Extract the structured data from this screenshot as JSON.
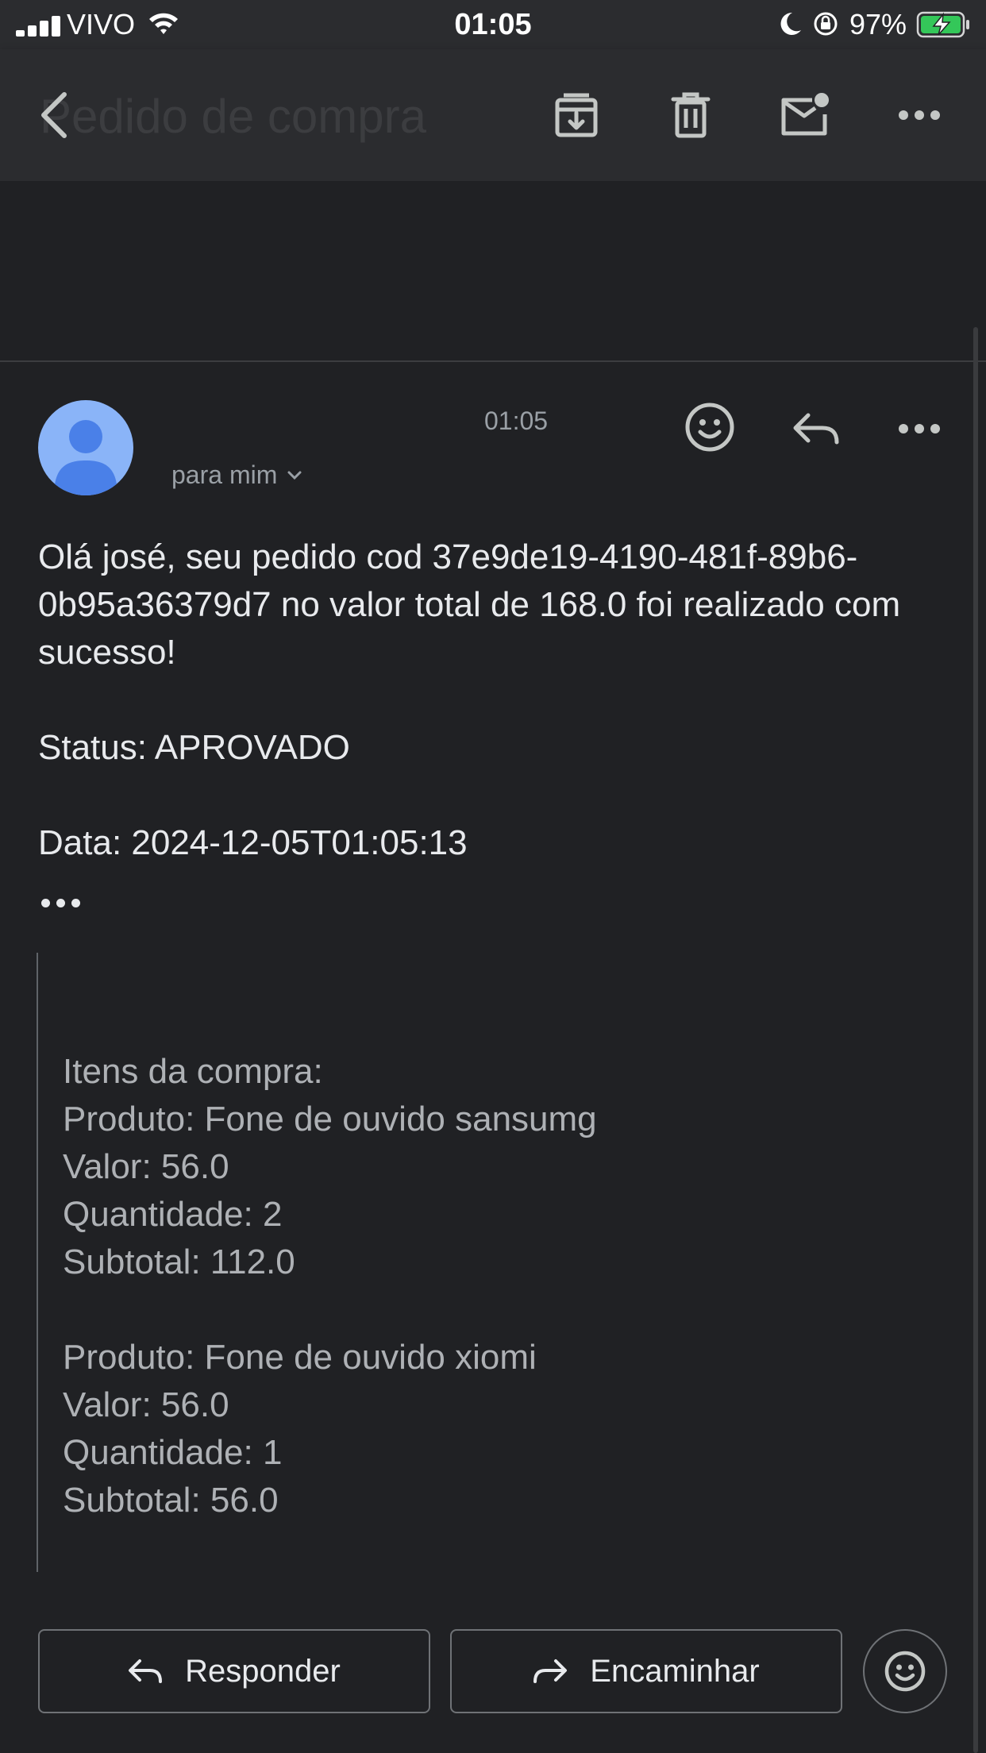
{
  "status_bar": {
    "carrier": "VIVO",
    "time": "01:05",
    "battery_percent": "97%"
  },
  "app_bar": {
    "subject": "Pedido de compra",
    "icons": [
      "back-arrow-icon",
      "archive-icon",
      "delete-icon",
      "mark-unread-icon",
      "more-icon"
    ]
  },
  "message": {
    "time": "01:05",
    "recipient": "para mim",
    "body": {
      "greeting": "Olá josé,  seu pedido cod 37e9de19-4190-481f-89b6-0b95a36379d7 no valor total de 168.0 foi realizado com sucesso!",
      "status": "Status: APROVADO",
      "date": "Data: 2024-12-05T01:05:13"
    },
    "quoted": {
      "heading": "Itens da compra:",
      "items": [
        {
          "produto": "Produto: Fone de ouvido sansumg",
          "valor": "Valor: 56.0",
          "quantidade": "Quantidade: 2",
          "subtotal": "Subtotal: 112.0"
        },
        {
          "produto": "Produto: Fone de ouvido xiomi",
          "valor": "Valor: 56.0",
          "quantidade": "Quantidade: 1",
          "subtotal": "Subtotal: 56.0"
        }
      ]
    }
  },
  "actions": {
    "reply_label": "Responder",
    "forward_label": "Encaminhar"
  },
  "colors": {
    "background": "#202124",
    "bar": "#2b2c2f",
    "text": "#e8eaed",
    "muted": "#9aa0a6",
    "avatar": "#8ab4f8",
    "avatar_figure": "#4a80e8",
    "battery_green": "#34c759"
  }
}
